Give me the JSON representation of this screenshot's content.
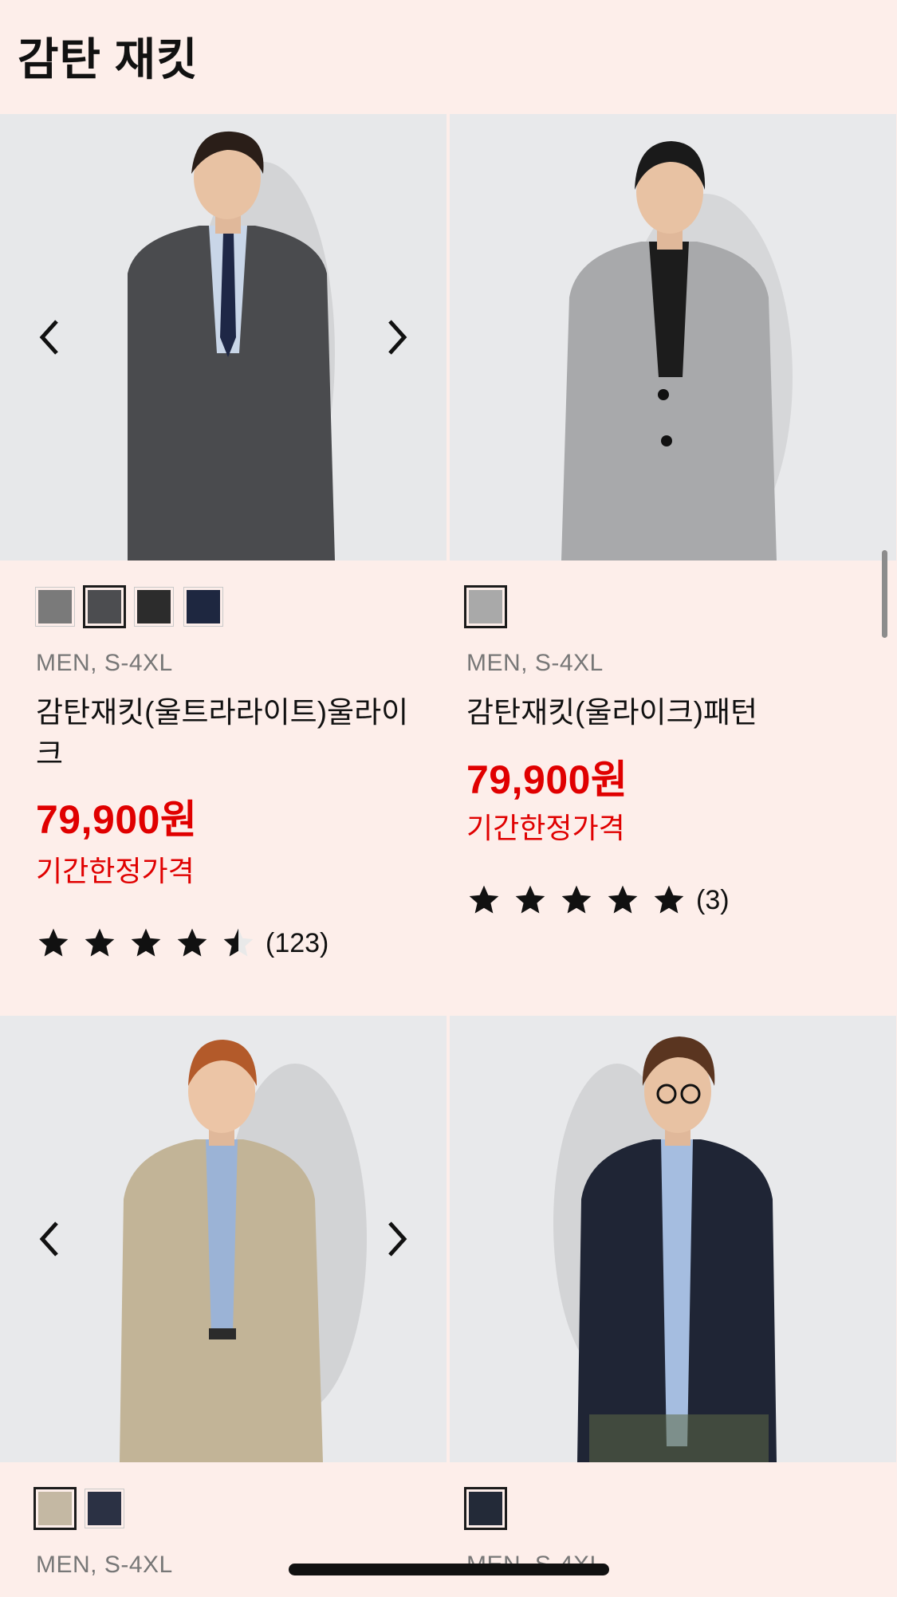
{
  "header": {
    "title": "감탄 재킷"
  },
  "products": [
    {
      "gender_size": "MEN, S-4XL",
      "name": "감탄재킷(울트라라이트)울라이크",
      "price": "79,900원",
      "promo": "기간한정가격",
      "rating": 4.5,
      "review_count": "(123)",
      "swatches": [
        "#7a7a7a",
        "#4c4d50",
        "#2c2c2c",
        "#1e2740"
      ],
      "selected_swatch": 1,
      "jacket_color": "#4a4b4e",
      "inner_color": "#c9d6e8"
    },
    {
      "gender_size": "MEN, S-4XL",
      "name": "감탄재킷(울라이크)패턴",
      "price": "79,900원",
      "promo": "기간한정가격",
      "rating": 5,
      "review_count": "(3)",
      "swatches": [
        "#a9a9a9"
      ],
      "selected_swatch": 0,
      "jacket_color": "#a8a9ab",
      "inner_color": "#1c1c1c"
    },
    {
      "gender_size": "MEN, S-4XL",
      "swatches": [
        "#c4b8a3",
        "#2b3144"
      ],
      "selected_swatch": 0,
      "jacket_color": "#c2b497",
      "inner_color": "#9bb3d6"
    },
    {
      "gender_size": "MEN, S-4XL",
      "swatches": [
        "#232a38"
      ],
      "selected_swatch": 0,
      "jacket_color": "#1f2535",
      "inner_color": "#a5bde0"
    }
  ],
  "icons": {
    "prev": "chevron-left-icon",
    "next": "chevron-right-icon",
    "star": "star-icon"
  }
}
